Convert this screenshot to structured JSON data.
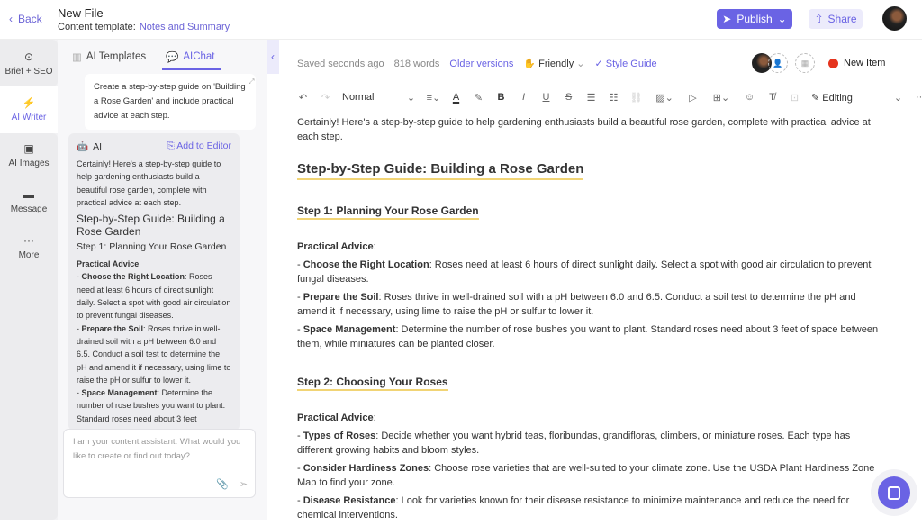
{
  "header": {
    "back_label": "Back",
    "title": "New File",
    "template_label": "Content template:",
    "template_value": "Notes and Summary",
    "publish_label": "Publish",
    "share_label": "Share"
  },
  "leftnav": {
    "items": [
      {
        "label": "Brief + SEO",
        "icon": "target-icon"
      },
      {
        "label": "AI Writer",
        "icon": "bolt-icon",
        "active": true
      },
      {
        "label": "AI Images",
        "icon": "image-icon"
      },
      {
        "label": "Message",
        "icon": "message-icon"
      },
      {
        "label": "More",
        "icon": "more-icon"
      }
    ]
  },
  "panel": {
    "tabs": [
      {
        "label": "AI Templates"
      },
      {
        "label": "AIChat",
        "active": true
      }
    ],
    "prompt": "Create a step-by-step guide on 'Building a Rose Garden' and include practical advice at each step.",
    "response": {
      "sender": "AI",
      "add_label": "Add to Editor",
      "intro": "Certainly! Here's a step-by-step guide to help gardening enthusiasts build a beautiful rose garden, complete with practical advice at each step.",
      "h1": "Step-by-Step Guide: Building a Rose Garden",
      "h2": "Step 1: Planning Your Rose Garden",
      "advice_label": "Practical Advice",
      "items": [
        {
          "bold": "Choose the Right Location",
          "text": ": Roses need at least 6 hours of direct sunlight daily. Select a spot with good air circulation to prevent fungal diseases."
        },
        {
          "bold": "Prepare the Soil",
          "text": ": Roses thrive in well-drained soil with a pH between 6.0 and 6.5. Conduct a soil test to determine the pH and amend it if necessary, using lime to raise the pH or sulfur to lower it."
        },
        {
          "bold": "Space Management",
          "text": ": Determine the number of rose bushes you want to plant. Standard roses need about 3 feet"
        }
      ]
    },
    "chat_placeholder": "I am your content assistant. What would you like to create or find out today?"
  },
  "editor": {
    "saved": "Saved seconds ago",
    "words": "818 words",
    "older_versions": "Older versions",
    "tone": "Friendly",
    "style_guide": "Style Guide",
    "new_item": "New Item",
    "toolbar": {
      "block_style": "Normal",
      "mode": "Editing"
    },
    "intro": "Certainly! Here's a step-by-step guide to help gardening enthusiasts build a beautiful rose garden, complete with practical advice at each step.",
    "h1": "Step-by-Step Guide: Building a Rose Garden",
    "step1": {
      "title": "Step 1: Planning Your Rose Garden",
      "advice": "Practical Advice",
      "items": [
        {
          "bold": "Choose the Right Location",
          "text": ": Roses need at least 6 hours of direct sunlight daily. Select a spot with good air circulation to prevent fungal diseases."
        },
        {
          "bold": "Prepare the Soil",
          "text": ": Roses thrive in well-drained soil with a pH between 6.0 and 6.5. Conduct a soil test to determine the pH and amend it if necessary, using lime to raise the pH or sulfur to lower it."
        },
        {
          "bold": "Space Management",
          "text": ": Determine the number of rose bushes you want to plant. Standard roses need about 3 feet of space between them, while miniatures can be planted closer."
        }
      ]
    },
    "step2": {
      "title": "Step 2: Choosing Your Roses",
      "advice": "Practical Advice",
      "items": [
        {
          "bold": "Types of Roses",
          "text": ": Decide whether you want hybrid teas, floribundas, grandifloras, climbers, or miniature roses. Each type has different growing habits and bloom styles."
        },
        {
          "bold": "Consider Hardiness Zones",
          "text": ": Choose rose varieties that are well-suited to your climate zone. Use the USDA Plant Hardiness Zone Map to find your zone."
        },
        {
          "bold": "Disease Resistance",
          "text": ": Look for varieties known for their disease resistance to minimize maintenance and reduce the need for chemical interventions."
        }
      ]
    }
  }
}
